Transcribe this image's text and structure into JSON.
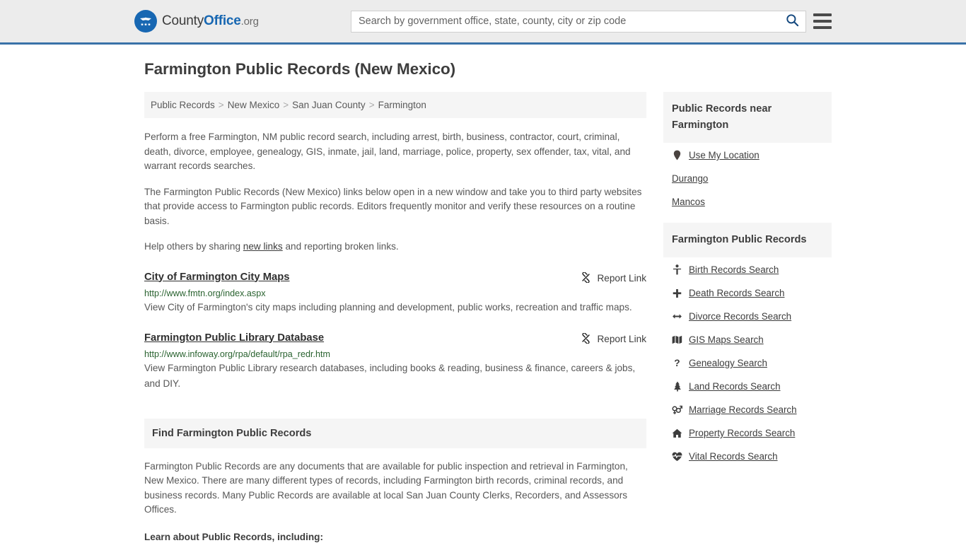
{
  "header": {
    "logo": {
      "icon": "eagle-shield-logo",
      "text_county": "County",
      "text_office": "Office",
      "text_org": ".org"
    },
    "search": {
      "placeholder": "Search by government office, state, county, city or zip code",
      "value": "",
      "icon": "search-icon"
    },
    "menu_icon": "hamburger-menu-icon"
  },
  "page": {
    "title": "Farmington Public Records (New Mexico)"
  },
  "breadcrumb": {
    "separator": ">",
    "items": [
      {
        "label": "Public Records"
      },
      {
        "label": "New Mexico"
      },
      {
        "label": "San Juan County"
      },
      {
        "label": "Farmington"
      }
    ]
  },
  "intro": {
    "paragraph1": "Perform a free Farmington, NM public record search, including arrest, birth, business, contractor, court, criminal, death, divorce, employee, genealogy, GIS, inmate, jail, land, marriage, police, property, sex offender, tax, vital, and warrant records searches.",
    "paragraph2": "The Farmington Public Records (New Mexico) links below open in a new window and take you to third party websites that provide access to Farmington public records. Editors frequently monitor and verify these resources on a routine basis.",
    "paragraph3_before": "Help others by sharing ",
    "paragraph3_link": "new links",
    "paragraph3_after": " and reporting broken links."
  },
  "listings": [
    {
      "title": "City of Farmington City Maps",
      "url": "http://www.fmtn.org/index.aspx",
      "description": "View City of Farmington's city maps including planning and development, public works, recreation and traffic maps.",
      "report_label": "Report Link",
      "report_icon": "broken-link-icon"
    },
    {
      "title": "Farmington Public Library Database",
      "url": "http://www.infoway.org/rpa/default/rpa_redr.htm",
      "description": "View Farmington Public Library research databases, including books & reading, business & finance, careers & jobs, and DIY.",
      "report_label": "Report Link",
      "report_icon": "broken-link-icon"
    }
  ],
  "find_section": {
    "heading": "Find Farmington Public Records",
    "paragraph1": "Farmington Public Records are any documents that are available for public inspection and retrieval in Farmington, New Mexico. There are many different types of records, including Farmington birth records, criminal records, and business records. Many Public Records are available at local San Juan County Clerks, Recorders, and Assessors Offices.",
    "paragraph2": "Learn about Public Records, including:"
  },
  "sidebar": {
    "near_panel": {
      "heading": "Public Records near Farmington",
      "items": [
        {
          "label": "Use My Location",
          "icon": "map-pin-icon"
        },
        {
          "label": "Durango",
          "icon": ""
        },
        {
          "label": "Mancos",
          "icon": ""
        }
      ]
    },
    "records_panel": {
      "heading": "Farmington Public Records",
      "items": [
        {
          "label": "Birth Records Search",
          "icon": "baby-icon"
        },
        {
          "label": "Death Records Search",
          "icon": "cross-icon"
        },
        {
          "label": "Divorce Records Search",
          "icon": "arrows-left-right-icon"
        },
        {
          "label": "GIS Maps Search",
          "icon": "map-icon"
        },
        {
          "label": "Genealogy Search",
          "icon": "question-mark-icon"
        },
        {
          "label": "Land Records Search",
          "icon": "tree-icon"
        },
        {
          "label": "Marriage Records Search",
          "icon": "venus-mars-icon"
        },
        {
          "label": "Property Records Search",
          "icon": "home-icon"
        },
        {
          "label": "Vital Records Search",
          "icon": "heartbeat-icon"
        }
      ]
    }
  },
  "colors": {
    "header_bg": "#ececec",
    "header_border": "#3a72a8",
    "brand_blue": "#1767b2",
    "panel_bg": "#f5f5f5",
    "url_green": "#2a6330",
    "body_text": "#575757"
  }
}
